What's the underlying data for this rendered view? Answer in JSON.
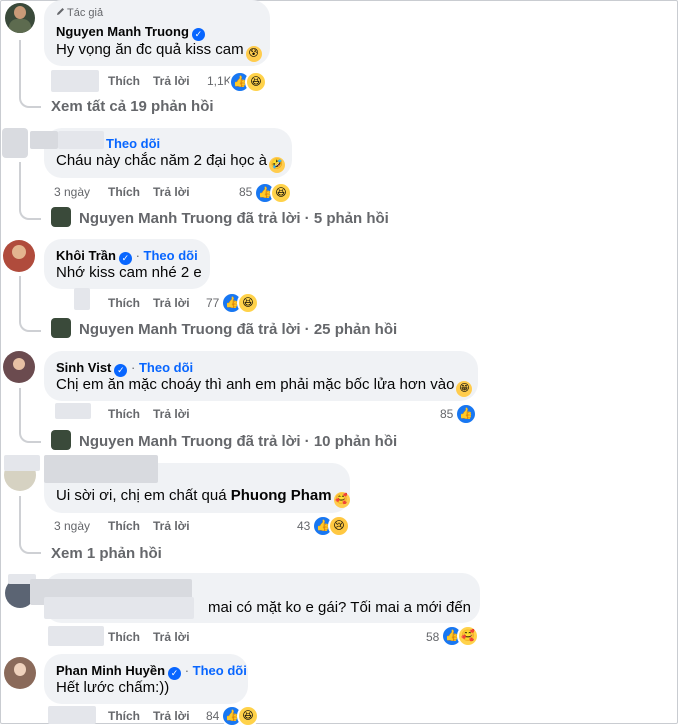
{
  "actions": {
    "like": "Thích",
    "reply": "Trả lời",
    "follow": "Theo dõi",
    "dot": "·"
  },
  "comments": [
    {
      "author_tag": "Tác giả",
      "author": "Nguyen Manh Truong",
      "text": "Hy vọng ăn đc quả kiss cam",
      "time": "",
      "reactions": "1,1K",
      "view_replies": "Xem tất cả 19 phản hồi"
    },
    {
      "author": "",
      "text": "Cháu này chắc năm 2 đại học à",
      "time": "3 ngày",
      "reactions": "85",
      "replied_by": "Nguyen Manh Truong",
      "replied_summary": "Nguyen Manh Truong đã trả lời · 5 phản hồi"
    },
    {
      "author": "Khôi Trần",
      "text": "Nhớ kiss cam nhé 2 e",
      "time": "",
      "reactions": "77",
      "replied_summary": "Nguyen Manh Truong đã trả lời · 25 phản hồi"
    },
    {
      "author": "Sinh Vist",
      "text": "Chị em ăn mặc choáy thì anh em phải mặc bốc lửa hơn vào",
      "time": "",
      "reactions": "85",
      "replied_summary": "Nguyen Manh Truong đã trả lời · 10 phản hồi"
    },
    {
      "author": "",
      "text_prefix": "Ui sời ơi, chị em chất quá",
      "tag": "Phuong Pham",
      "time": "3 ngày",
      "reactions": "43",
      "view_replies": "Xem 1 phản hồi"
    },
    {
      "author": "",
      "text": "mai có mặt ko e gái? Tối mai a mới đến",
      "time": "",
      "reactions": "58"
    },
    {
      "author": "Phan Minh Huyền",
      "text": "Hết lước chấm:))",
      "time": "",
      "reactions": "84"
    }
  ],
  "icons": {
    "author_badge": "pencil-icon",
    "verified": "verified-badge-icon",
    "like": "like-reaction-icon",
    "haha": "haha-reaction-icon",
    "sad": "sad-reaction-icon",
    "care": "care-reaction-icon"
  },
  "colors": {
    "accent": "#0866ff",
    "bubble": "#f0f2f5",
    "muted": "#65676b",
    "like": "#1877f2"
  }
}
